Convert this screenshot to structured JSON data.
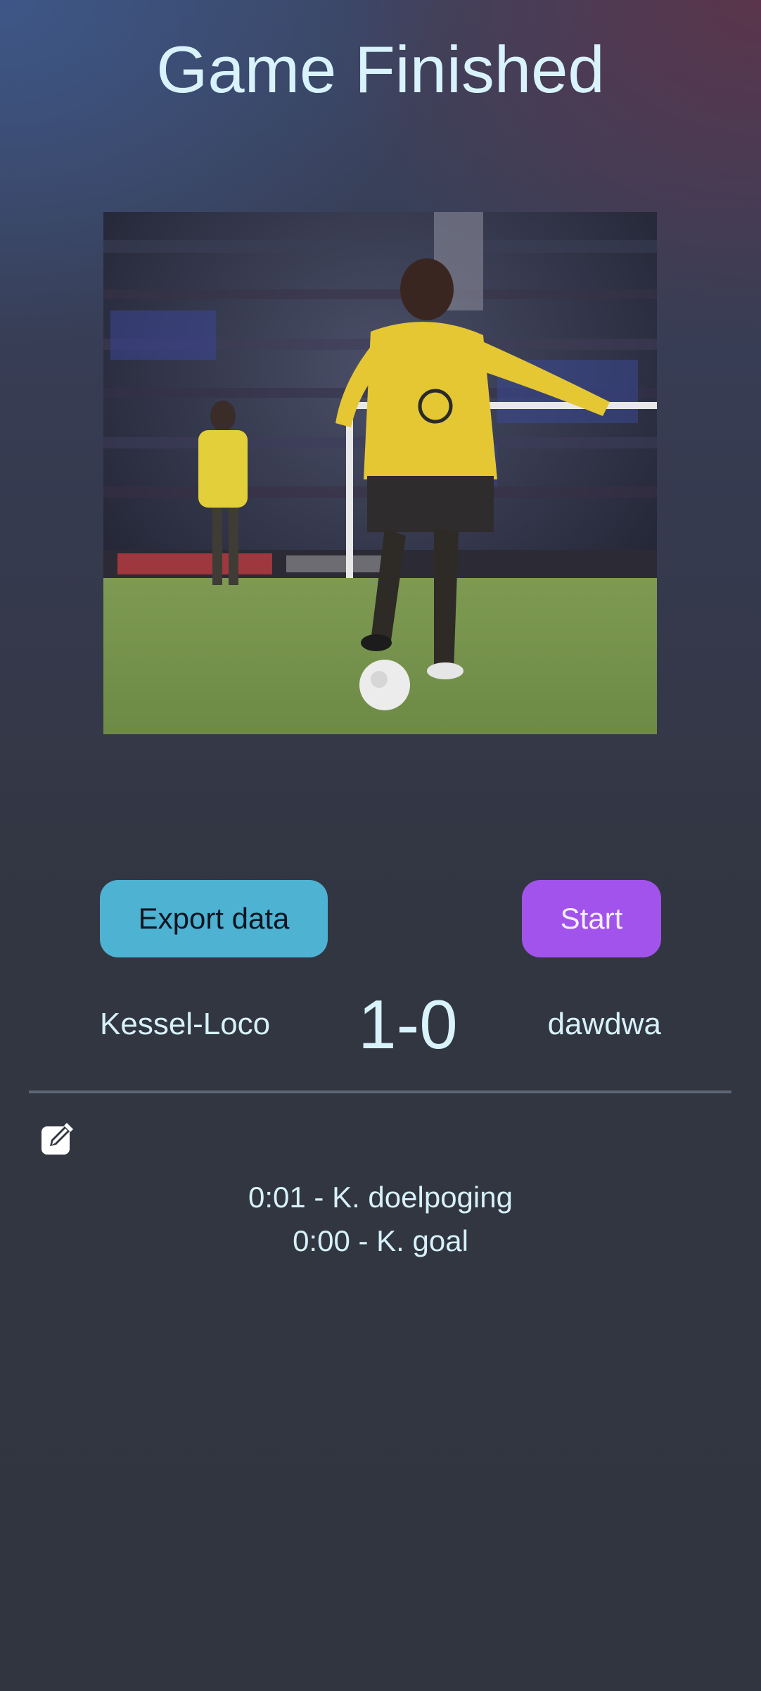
{
  "header": {
    "title": "Game Finished"
  },
  "media": {
    "gif_alt": "soccer-player-kicking-ball-animation"
  },
  "actions": {
    "export_label": "Export data",
    "start_label": "Start"
  },
  "match": {
    "home_team": "Kessel-Loco",
    "away_team": "dawdwa",
    "score": "1-0"
  },
  "log": {
    "edit_icon": "edit-icon",
    "events": [
      "0:01 - K. doelpoging",
      "0:00 - K. goal"
    ]
  },
  "colors": {
    "export_button": "#4eb2d2",
    "start_button": "#a253ec",
    "text": "#d7f1fb",
    "divider": "#5d6778"
  }
}
